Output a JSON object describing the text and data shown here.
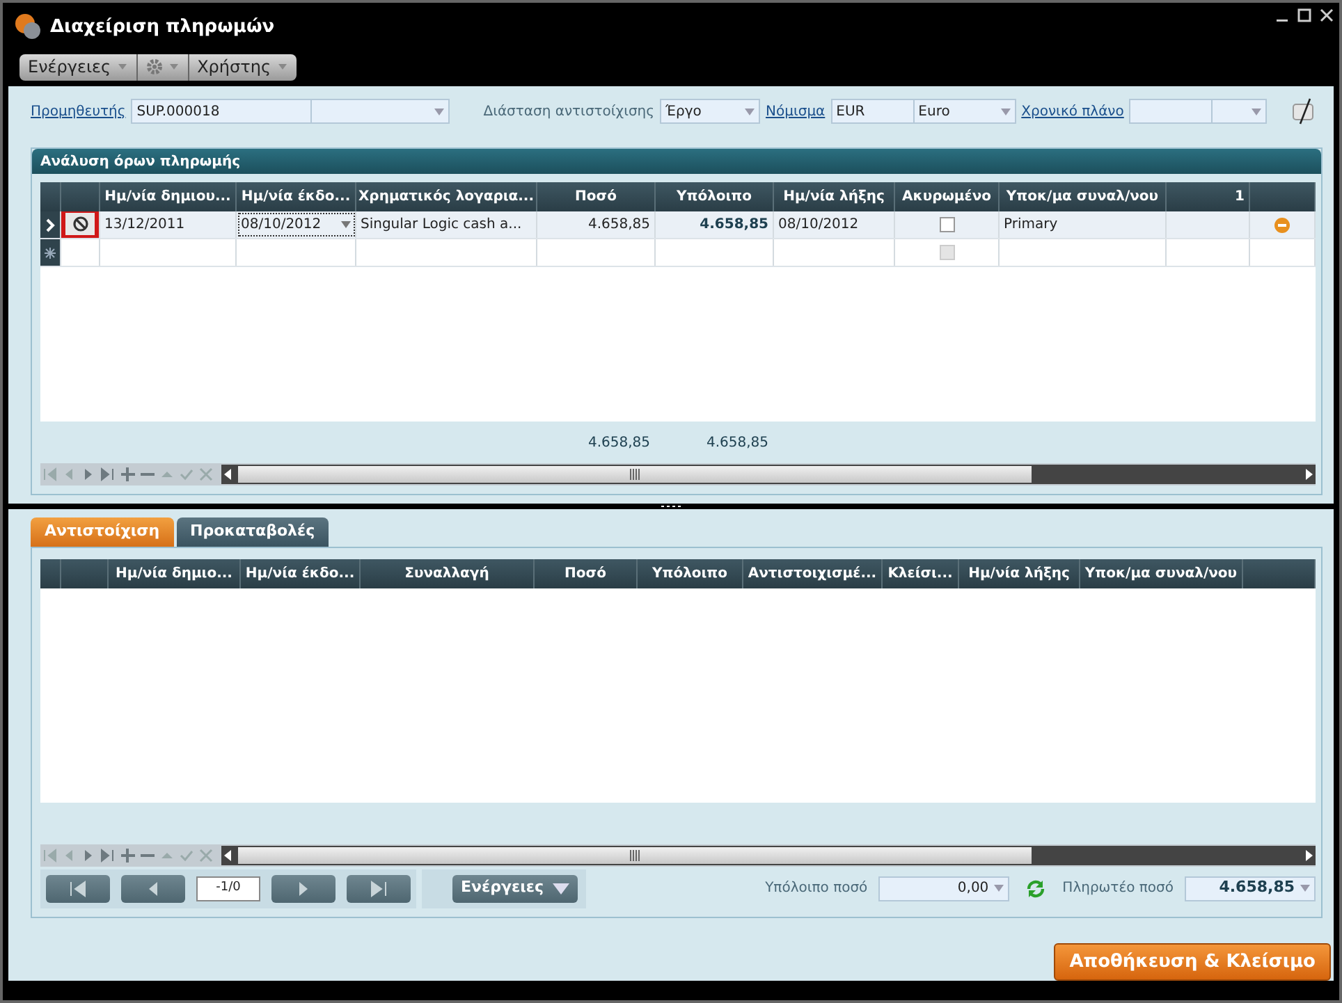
{
  "window": {
    "title": "Διαχείριση πληρωμών"
  },
  "menu": [
    {
      "kind": "text",
      "label": "Ενέργειες"
    },
    {
      "kind": "gear"
    },
    {
      "kind": "text",
      "label": "Χρήστης"
    }
  ],
  "filters": {
    "supplier": {
      "label": "Προμηθευτής",
      "code": "SUP.000018"
    },
    "dimension": {
      "label": "Διάσταση αντιστοίχισης",
      "value": "Έργο"
    },
    "currency": {
      "label": "Νόμισμα",
      "code": "EUR",
      "name": "Euro"
    },
    "plan": {
      "label": "Χρονικό πλάνο"
    }
  },
  "terms": {
    "title": "Ανάλυση όρων πληρωμής",
    "columns": [
      "Ημ/νία δημιου...",
      "Ημ/νία έκδο...",
      "Χρηματικός λογαρια...",
      "Ποσό",
      "Υπόλοιπο",
      "Ημ/νία λήξης",
      "Ακυρωμένο",
      "Υποκ/μα συναλ/νου",
      "1"
    ],
    "rows": [
      {
        "kind": "data",
        "current": true,
        "disabled": false,
        "cancelled": false,
        "cells": [
          "13/12/2011",
          "08/10/2012",
          "Singular Logic cash a...",
          "4.658,85",
          "4.658,85",
          "08/10/2012",
          "",
          "Primary",
          ""
        ]
      },
      {
        "kind": "new",
        "current": false,
        "disabled": true,
        "cancelled": false,
        "cells": [
          "",
          "",
          "",
          "",
          "",
          "",
          "",
          "",
          ""
        ]
      }
    ],
    "totals": [
      "4.658,85",
      "4.658,85"
    ]
  },
  "tabs": [
    {
      "label": "Αντιστοίχιση",
      "selected": true
    },
    {
      "label": "Προκαταβολές",
      "selected": false
    }
  ],
  "matching": {
    "columns": [
      "Ημ/νία δημιο...",
      "Ημ/νία έκδο...",
      "Συναλλαγή",
      "Ποσό",
      "Υπόλοιπο",
      "Αντιστοιχισμέ...",
      "Κλείσι...",
      "Ημ/νία λήξης",
      "Υποκ/μα συναλ/νου"
    ]
  },
  "pager": {
    "position": "-1/0",
    "actions": "Ενέργειες"
  },
  "summary": {
    "balance_label": "Υπόλοιπο ποσό",
    "balance": "0,00",
    "payable_label": "Πληρωτέο ποσό",
    "payable": "4.658,85"
  },
  "save_button": "Αποθήκευση & Κλείσιμο"
}
